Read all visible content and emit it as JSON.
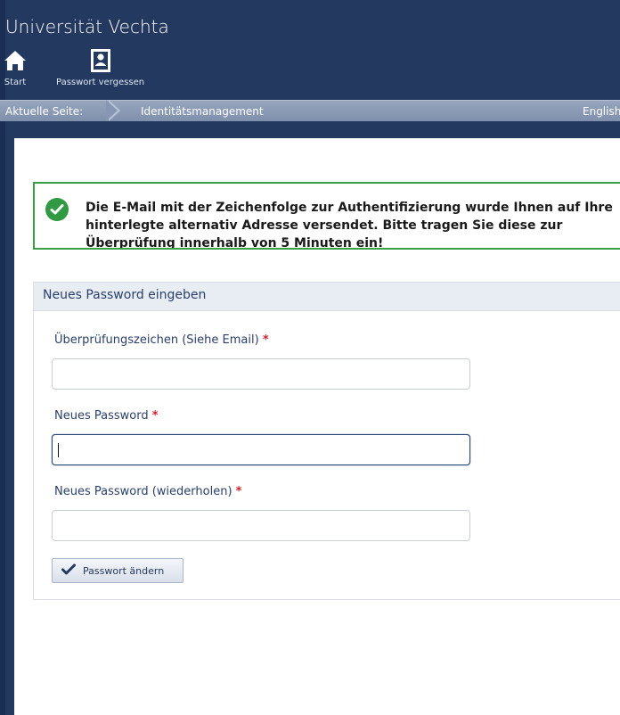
{
  "app": {
    "title": "Universität Vechta"
  },
  "nav": {
    "start_label": "Start",
    "start_icon": "home-icon",
    "password_forgot_label": "Passwort vergessen",
    "password_forgot_icon": "user-card-icon"
  },
  "breadcrumb": {
    "label": "Aktuelle Seite:",
    "current": "Identitätsmanagement",
    "language": "English"
  },
  "alert": {
    "icon": "check-circle-icon",
    "message": "Die E-Mail mit der Zeichenfolge zur Authentifizierung wurde Ihnen auf Ihre hinterlegte alternativ Adresse versendet. Bitte tragen Sie diese zur Überprüfung innerhalb von 5 Minuten ein!",
    "color": "#3aa047"
  },
  "form": {
    "title": "Neues Password eingeben",
    "fields": [
      {
        "label": "Überprüfungszeichen (Siehe Email)",
        "required_mark": "*",
        "value": ""
      },
      {
        "label": "Neues Password",
        "required_mark": "*",
        "value": ""
      },
      {
        "label": "Neues Password (wiederholen)",
        "required_mark": "*",
        "value": ""
      }
    ],
    "submit_label": "Passwort ändern",
    "submit_icon": "checkmark-icon"
  },
  "colors": {
    "header_bg": "#23395f",
    "accent_text": "#2a3f69",
    "required": "#d21f2a"
  }
}
